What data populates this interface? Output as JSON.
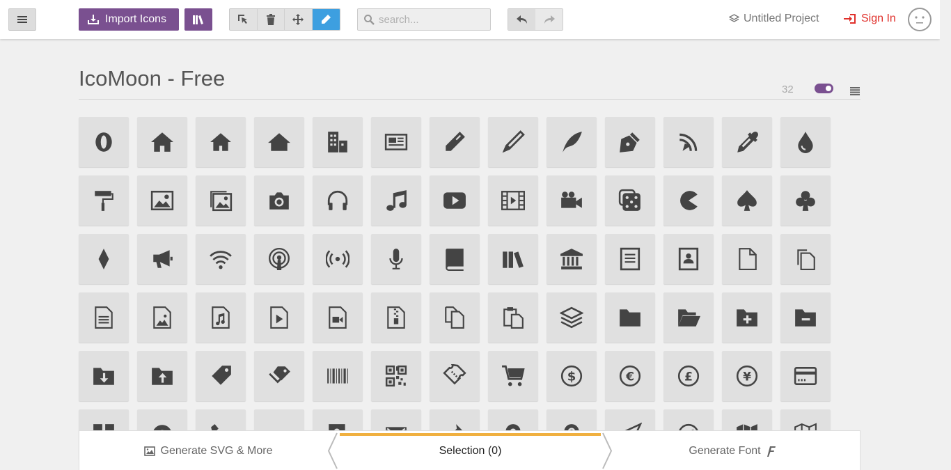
{
  "header": {
    "import_label": "Import Icons",
    "search_placeholder": "search...",
    "project_label": "Untitled Project",
    "signin_label": "Sign In"
  },
  "icon_set": {
    "title": "IcoMoon - Free",
    "count": "32"
  },
  "footer": {
    "generate_svg_label": "Generate SVG & More",
    "selection_label": "Selection (0)",
    "generate_font_label": "Generate Font"
  },
  "colors": {
    "brand": "#7a5090",
    "active_tool": "#3d9fe0",
    "signin": "#e0302b",
    "selection_bar": "#f0b040"
  },
  "icons": [
    "icomoon",
    "home",
    "home2",
    "home3",
    "office",
    "newspaper",
    "pencil",
    "pencil2",
    "quill",
    "pen",
    "blog",
    "eyedropper",
    "droplet",
    "paint-format",
    "image",
    "images",
    "camera",
    "headphones",
    "music",
    "play",
    "film",
    "video-camera",
    "dice",
    "pacman",
    "spades",
    "clubs",
    "diamonds",
    "bullhorn",
    "connection",
    "podcast",
    "feed",
    "mic",
    "book",
    "books",
    "library",
    "file-text",
    "profile",
    "file-empty",
    "files-empty",
    "file-text2",
    "file-picture",
    "file-music",
    "file-play",
    "file-video",
    "file-zip",
    "copy",
    "paste",
    "stack",
    "folder",
    "folder-open",
    "folder-plus",
    "folder-minus",
    "folder-download",
    "folder-upload",
    "price-tag",
    "price-tags",
    "barcode",
    "qrcode",
    "ticket",
    "cart",
    "coin-dollar",
    "coin-euro",
    "coin-pound",
    "coin-yen",
    "credit-card",
    "calculator",
    "lifebuoy",
    "phone",
    "phone-hang-up",
    "address-book",
    "envelop",
    "pushpin",
    "location",
    "location2",
    "compass",
    "compass2",
    "map",
    "map2"
  ]
}
